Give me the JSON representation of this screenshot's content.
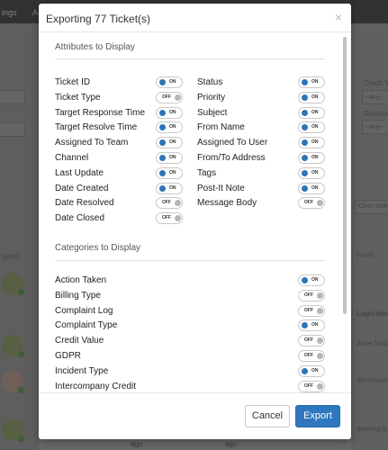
{
  "background": {
    "topbar_left": "ings",
    "topbar_left2": "A",
    "right_labels": {
      "credit": "Credit V",
      "any1": "--Any--",
      "resolution": "Resolut",
      "any2": "--Any--",
      "clear": "Clear Sele",
      "from": "From"
    },
    "left_labels": {
      "assigned": "igned",
      "dash": "-"
    },
    "right_rows": [
      "Logicalwa",
      "Jane Smith",
      "aliceinwor",
      "danielgric"
    ],
    "ago1": "ago",
    "ago2": "ago"
  },
  "modal": {
    "title": "Exporting 77 Ticket(s)",
    "close_icon": "×",
    "attributes_title": "Attributes to Display",
    "attributes_left": [
      {
        "label": "Ticket ID",
        "state": "ON"
      },
      {
        "label": "Ticket Type",
        "state": "OFF"
      },
      {
        "label": "Target Response Time",
        "state": "ON"
      },
      {
        "label": "Target Resolve Time",
        "state": "ON"
      },
      {
        "label": "Assigned To Team",
        "state": "ON"
      },
      {
        "label": "Channel",
        "state": "ON"
      },
      {
        "label": "Last Update",
        "state": "ON"
      },
      {
        "label": "Date Created",
        "state": "ON"
      },
      {
        "label": "Date Resolved",
        "state": "OFF"
      },
      {
        "label": "Date Closed",
        "state": "OFF"
      }
    ],
    "attributes_right": [
      {
        "label": "Status",
        "state": "ON"
      },
      {
        "label": "Priority",
        "state": "ON"
      },
      {
        "label": "Subject",
        "state": "ON"
      },
      {
        "label": "From Name",
        "state": "ON"
      },
      {
        "label": "Assigned To User",
        "state": "ON"
      },
      {
        "label": "From/To Address",
        "state": "ON"
      },
      {
        "label": "Tags",
        "state": "ON"
      },
      {
        "label": "Post-It Note",
        "state": "ON"
      },
      {
        "label": "Message Body",
        "state": "OFF"
      }
    ],
    "categories_title": "Categories to Display",
    "categories": [
      {
        "label": "Action Taken",
        "state": "ON"
      },
      {
        "label": "Billing Type",
        "state": "OFF"
      },
      {
        "label": "Complaint Log",
        "state": "OFF"
      },
      {
        "label": "Complaint Type",
        "state": "ON"
      },
      {
        "label": "Credit Value",
        "state": "OFF"
      },
      {
        "label": "GDPR",
        "state": "OFF"
      },
      {
        "label": "Incident Type",
        "state": "ON"
      },
      {
        "label": "Intercompany Credit",
        "state": "OFF"
      }
    ],
    "cancel_label": "Cancel",
    "export_label": "Export"
  },
  "colors": {
    "accent": "#2f78bf",
    "toggle_on_dot": "#2e75b6",
    "toggle_off_dot": "#b5b5b5"
  }
}
